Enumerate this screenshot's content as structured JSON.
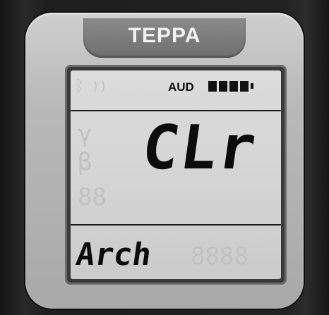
{
  "device": {
    "brand": "TEPPA"
  },
  "lcd": {
    "audio_indicator": "AUD",
    "battery_level": 1.0,
    "main_display": "CLr",
    "bottom_display": "Arch"
  }
}
